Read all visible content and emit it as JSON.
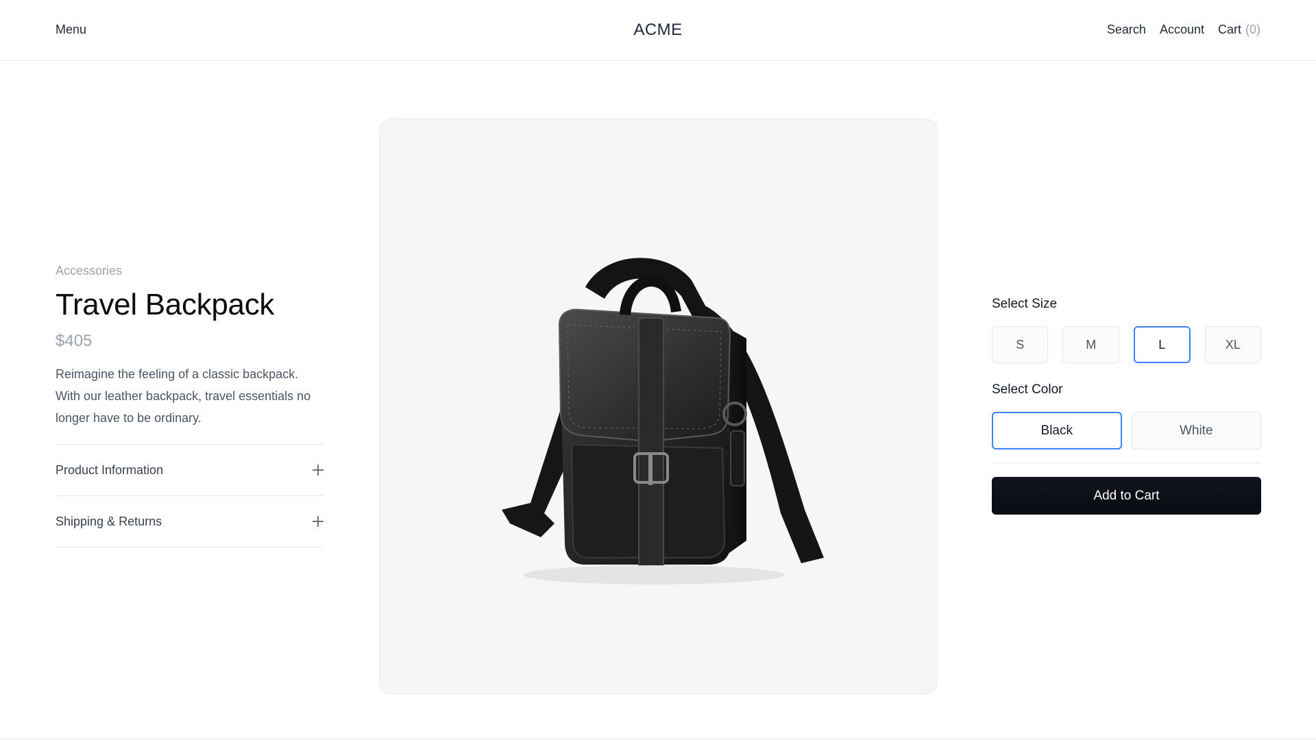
{
  "header": {
    "menu_label": "Menu",
    "brand": "ACME",
    "search_label": "Search",
    "account_label": "Account",
    "cart_label": "Cart",
    "cart_count": "(0)"
  },
  "product": {
    "category": "Accessories",
    "title": "Travel Backpack",
    "price": "$405",
    "description": "Reimagine the feeling of a classic backpack. With our leather backpack, travel essentials no longer have to be ordinary.",
    "image_alt": "black-leather-backpack-image"
  },
  "accordion": [
    {
      "label": "Product Information"
    },
    {
      "label": "Shipping & Returns"
    }
  ],
  "options": {
    "size_label": "Select Size",
    "sizes": [
      "S",
      "M",
      "L",
      "XL"
    ],
    "selected_size": "L",
    "color_label": "Select Color",
    "colors": [
      "Black",
      "White"
    ],
    "selected_color": "Black"
  },
  "cta": {
    "add_to_cart": "Add to Cart"
  },
  "theme": {
    "accent": "#3b82f6",
    "button_bg": "#0b0d14",
    "muted_text": "#9ca3af"
  }
}
